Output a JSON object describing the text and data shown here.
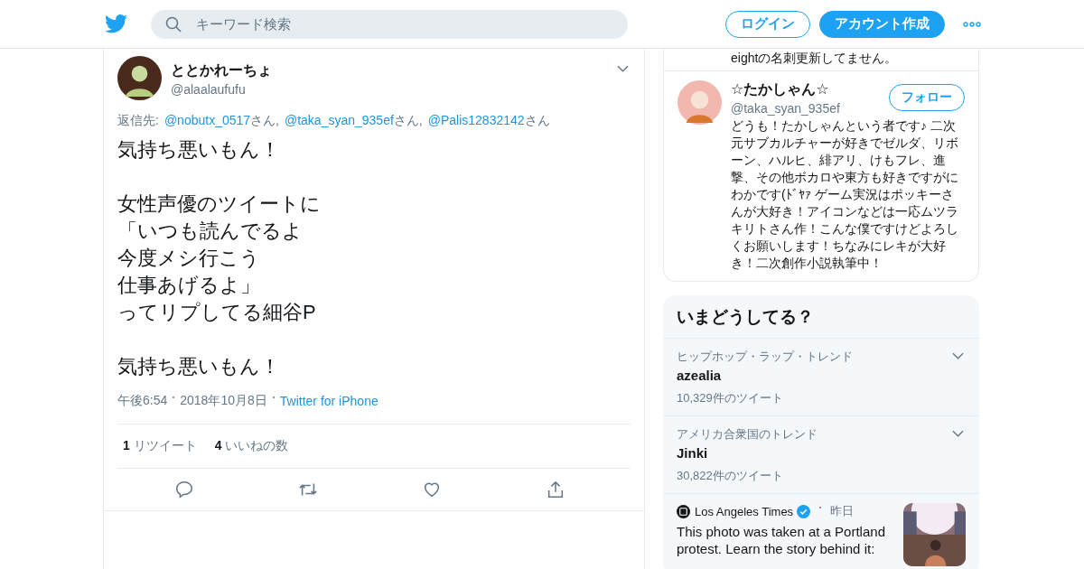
{
  "header": {
    "search": {
      "placeholder": "キーワード検索"
    },
    "buttons": [
      {
        "label": "ログイン",
        "kind": "outline"
      },
      {
        "label": "アカウント作成",
        "kind": "filled"
      }
    ]
  },
  "tweet": {
    "name": "ととかれーちょ",
    "handle": "@alaalaufufu",
    "reply_prefix": "返信先:",
    "reply_to": [
      {
        "handle": "@nobutx_0517",
        "suffix": "さん,"
      },
      {
        "handle": "@taka_syan_935ef",
        "suffix": "さん,"
      },
      {
        "handle": "@Palis12832142",
        "suffix": "さん"
      }
    ],
    "paragraphs": [
      [
        "気持ち悪いもん！"
      ],
      [
        "女性声優のツイートに",
        "「いつも読んでるよ",
        "今度メシ行こう",
        "仕事あげるよ」",
        "ってリプしてる細谷P"
      ],
      [
        "気持ち悪いもん！"
      ]
    ],
    "time": "午後6:54",
    "date": "2018年10月8日",
    "source": "Twitter for iPhone",
    "stats": [
      {
        "count": "1",
        "label": "リツイート"
      },
      {
        "count": "4",
        "label": "いいねの数"
      }
    ]
  },
  "profile": {
    "bio_tail": "eightの名刺更新してません。",
    "name": "☆たかしゃん☆",
    "handle": "@taka_syan_935ef",
    "follow": "フォロー",
    "bio": "どうも！たかしゃんという者です♪ 二次元サブカルチャーが好きでゼルダ、リボーン、ハルヒ、緋アリ、けもフレ、進撃、その他ボカロや東方も好きですがにわかです(ﾄﾞﾔｧ ゲーム実況はポッキーさんが大好き！アイコンなどは一応ムツラキリトさん作！こんな僕ですけどよろしくお願いします！ちなみにレキが大好き！二次創作小説執筆中！"
  },
  "trends": {
    "title": "いまどうしてる？",
    "items": [
      {
        "kind": "trend",
        "context": "ヒップホップ・ラップ・トレンド",
        "name": "azealia",
        "count": "10,329件のツイート"
      },
      {
        "kind": "trend",
        "context": "アメリカ合衆国のトレンド",
        "name": "Jinki",
        "count": "30,822件のツイート"
      },
      {
        "kind": "news",
        "source": "Los Angeles Times",
        "verified": true,
        "time": "昨日",
        "text": "This photo was taken at a Portland protest. Learn the story behind it:"
      }
    ]
  }
}
